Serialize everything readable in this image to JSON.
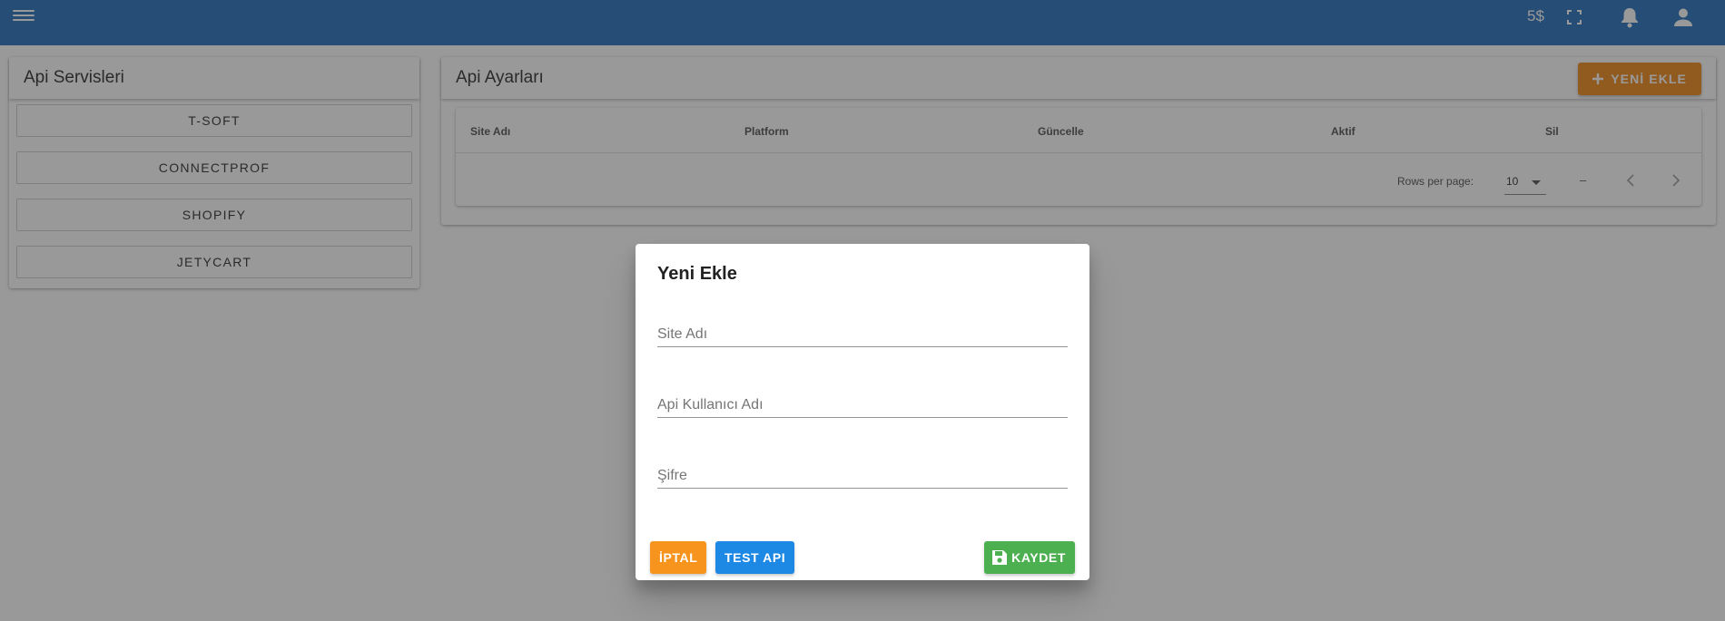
{
  "topbar": {
    "balance": "5$",
    "icons": [
      "menu-icon",
      "fullscreen-icon",
      "bell-icon",
      "account-icon"
    ]
  },
  "services": {
    "title": "Api Servisleri",
    "items": [
      {
        "label": "T-SOFT"
      },
      {
        "label": "CONNECTPROF"
      },
      {
        "label": "SHOPIFY"
      },
      {
        "label": "JETYCART"
      }
    ]
  },
  "settings": {
    "title": "Api Ayarları",
    "add_label": "YENİ EKLE",
    "columns": [
      "Site Adı",
      "Platform",
      "Güncelle",
      "Aktif",
      "Sil"
    ],
    "rows_per_page_label": "Rows per page:",
    "rows_per_page_value": "10",
    "range_text": "–"
  },
  "dialog": {
    "title": "Yeni Ekle",
    "fields": {
      "site_name_placeholder": "Site Adı",
      "api_user_placeholder": "Api Kullanıcı Adı",
      "password_placeholder": "Şifre"
    },
    "cancel_label": "İPTAL",
    "test_label": "TEST API",
    "save_label": "KAYDET"
  },
  "colors": {
    "topbar": "#2a73bd",
    "accent_orange": "#f08c1e",
    "cancel_orange": "#f7941d",
    "test_blue": "#1e88e5",
    "save_green": "#4caf50"
  }
}
